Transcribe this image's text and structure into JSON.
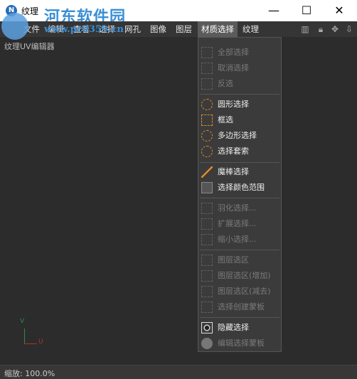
{
  "window": {
    "title": "纹理",
    "controls": {
      "minimize": "—",
      "maximize": "☐",
      "close": "✕"
    }
  },
  "watermark": {
    "site_name": "河东软件园",
    "url": "www.pc0359.cn"
  },
  "menubar": {
    "items": [
      {
        "label": "文件"
      },
      {
        "label": "编辑"
      },
      {
        "label": "查看"
      },
      {
        "label": "选择"
      },
      {
        "label": "网孔"
      },
      {
        "label": "图像"
      },
      {
        "label": "图层"
      },
      {
        "label": "材质选择",
        "active": true
      },
      {
        "label": "纹理"
      }
    ],
    "tool_icons": [
      "bar-chart-icon",
      "lock-icon",
      "move-icon",
      "arrows-down-icon"
    ]
  },
  "editor": {
    "label": "纹理UV编辑器",
    "axis_v": "V",
    "axis_u": "U"
  },
  "dropdown": {
    "items": [
      {
        "label": "全部选择",
        "enabled": false,
        "icon": "select-all-icon"
      },
      {
        "label": "取消选择",
        "enabled": false,
        "icon": "deselect-icon"
      },
      {
        "label": "反选",
        "enabled": false,
        "icon": "invert-icon"
      },
      {
        "label": "圆形选择",
        "enabled": true,
        "icon": "circle-select-icon"
      },
      {
        "label": "框选",
        "enabled": true,
        "icon": "box-select-icon"
      },
      {
        "label": "多边形选择",
        "enabled": true,
        "icon": "polygon-select-icon"
      },
      {
        "label": "选择套索",
        "enabled": true,
        "icon": "lasso-icon"
      },
      {
        "label": "魔棒选择",
        "enabled": true,
        "icon": "magic-wand-icon"
      },
      {
        "label": "选择颜色范围",
        "enabled": true,
        "icon": "color-range-icon"
      },
      {
        "label": "羽化选择...",
        "enabled": false,
        "icon": "feather-icon"
      },
      {
        "label": "扩展选择...",
        "enabled": false,
        "icon": "expand-icon"
      },
      {
        "label": "缩小选择...",
        "enabled": false,
        "icon": "shrink-icon"
      },
      {
        "label": "图层选区",
        "enabled": false,
        "icon": "layer-select-icon"
      },
      {
        "label": "图层选区(增加)",
        "enabled": false,
        "icon": "layer-add-icon"
      },
      {
        "label": "图层选区(减去)",
        "enabled": false,
        "icon": "layer-subtract-icon"
      },
      {
        "label": "选择创建蒙板",
        "enabled": false,
        "icon": "create-mask-icon"
      },
      {
        "label": "隐藏选择",
        "enabled": true,
        "icon": "hide-select-icon"
      },
      {
        "label": "编辑选择蒙板",
        "enabled": false,
        "icon": "edit-mask-icon"
      }
    ]
  },
  "status": {
    "zoom_text": "缩放: 100.0%"
  },
  "colors": {
    "accent": "#e08a2a",
    "background": "#2c2c2c",
    "menu_active": "#5b5b5b"
  }
}
